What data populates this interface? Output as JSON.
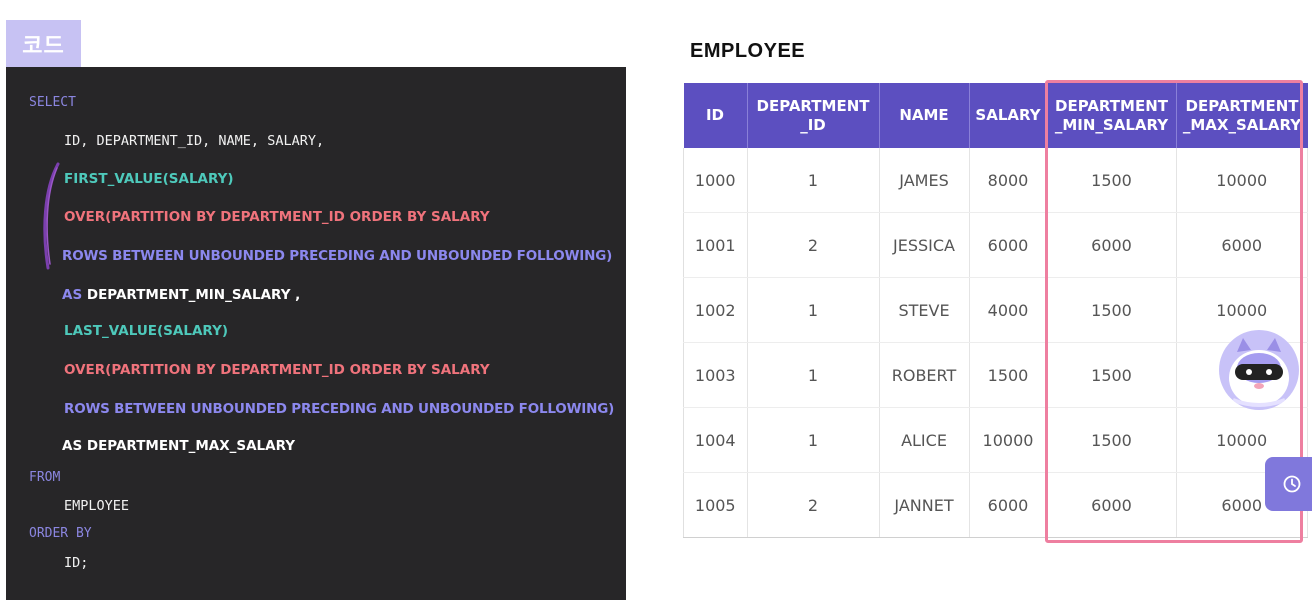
{
  "code_tab": {
    "label": "코드"
  },
  "code": {
    "select_kw": "SELECT",
    "select_cols": "ID, DEPARTMENT_ID, NAME, SALARY,",
    "first_value": "FIRST_VALUE(SALARY)",
    "over1": "OVER(PARTITION BY DEPARTMENT_ID ORDER BY SALARY",
    "rows1": "ROWS BETWEEN UNBOUNDED PRECEDING AND UNBOUNDED FOLLOWING)",
    "as1_kw": "AS",
    "as1_name": "DEPARTMENT_MIN_SALARY ,",
    "last_value": "LAST_VALUE(SALARY)",
    "over2": "OVER(PARTITION BY DEPARTMENT_ID ORDER BY SALARY",
    "rows2": "ROWS BETWEEN UNBOUNDED PRECEDING AND UNBOUNDED FOLLOWING)",
    "as2": "AS DEPARTMENT_MAX_SALARY",
    "from_kw": "FROM",
    "from_table": "EMPLOYEE",
    "order_kw": "ORDER BY",
    "order_col": "ID;"
  },
  "table": {
    "title": "EMPLOYEE",
    "headers": [
      "ID",
      "DEPARTMENT\n_ID",
      "NAME",
      "SALARY",
      "DEPARTMENT\n_MIN_SALARY",
      "DEPARTMENT\n_MAX_SALARY"
    ],
    "rows": [
      [
        "1000",
        "1",
        "JAMES",
        "8000",
        "1500",
        "10000"
      ],
      [
        "1001",
        "2",
        "JESSICA",
        "6000",
        "6000",
        "6000"
      ],
      [
        "1002",
        "1",
        "STEVE",
        "4000",
        "1500",
        "10000"
      ],
      [
        "1003",
        "1",
        "ROBERT",
        "1500",
        "1500",
        "1"
      ],
      [
        "1004",
        "1",
        "ALICE",
        "10000",
        "1500",
        "10000"
      ],
      [
        "1005",
        "2",
        "JANNET",
        "6000",
        "6000",
        "6000"
      ]
    ]
  },
  "colors": {
    "header_bg": "#5c4fc0",
    "highlight_border": "#ee7fa0",
    "code_bg": "#272628"
  },
  "icons": {
    "side_button": "clock-icon",
    "mascot": "cat-mascot-icon"
  }
}
